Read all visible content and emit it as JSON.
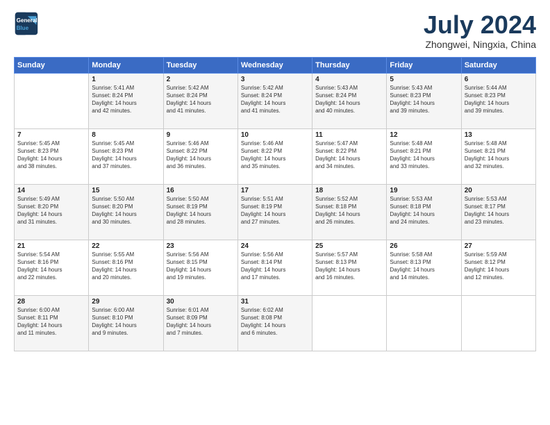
{
  "logo": {
    "line1": "General",
    "line2": "Blue"
  },
  "title": "July 2024",
  "subtitle": "Zhongwei, Ningxia, China",
  "header_days": [
    "Sunday",
    "Monday",
    "Tuesday",
    "Wednesday",
    "Thursday",
    "Friday",
    "Saturday"
  ],
  "weeks": [
    [
      {
        "day": "",
        "info": ""
      },
      {
        "day": "1",
        "info": "Sunrise: 5:41 AM\nSunset: 8:24 PM\nDaylight: 14 hours\nand 42 minutes."
      },
      {
        "day": "2",
        "info": "Sunrise: 5:42 AM\nSunset: 8:24 PM\nDaylight: 14 hours\nand 41 minutes."
      },
      {
        "day": "3",
        "info": "Sunrise: 5:42 AM\nSunset: 8:24 PM\nDaylight: 14 hours\nand 41 minutes."
      },
      {
        "day": "4",
        "info": "Sunrise: 5:43 AM\nSunset: 8:24 PM\nDaylight: 14 hours\nand 40 minutes."
      },
      {
        "day": "5",
        "info": "Sunrise: 5:43 AM\nSunset: 8:23 PM\nDaylight: 14 hours\nand 39 minutes."
      },
      {
        "day": "6",
        "info": "Sunrise: 5:44 AM\nSunset: 8:23 PM\nDaylight: 14 hours\nand 39 minutes."
      }
    ],
    [
      {
        "day": "7",
        "info": "Sunrise: 5:45 AM\nSunset: 8:23 PM\nDaylight: 14 hours\nand 38 minutes."
      },
      {
        "day": "8",
        "info": "Sunrise: 5:45 AM\nSunset: 8:23 PM\nDaylight: 14 hours\nand 37 minutes."
      },
      {
        "day": "9",
        "info": "Sunrise: 5:46 AM\nSunset: 8:22 PM\nDaylight: 14 hours\nand 36 minutes."
      },
      {
        "day": "10",
        "info": "Sunrise: 5:46 AM\nSunset: 8:22 PM\nDaylight: 14 hours\nand 35 minutes."
      },
      {
        "day": "11",
        "info": "Sunrise: 5:47 AM\nSunset: 8:22 PM\nDaylight: 14 hours\nand 34 minutes."
      },
      {
        "day": "12",
        "info": "Sunrise: 5:48 AM\nSunset: 8:21 PM\nDaylight: 14 hours\nand 33 minutes."
      },
      {
        "day": "13",
        "info": "Sunrise: 5:48 AM\nSunset: 8:21 PM\nDaylight: 14 hours\nand 32 minutes."
      }
    ],
    [
      {
        "day": "14",
        "info": "Sunrise: 5:49 AM\nSunset: 8:20 PM\nDaylight: 14 hours\nand 31 minutes."
      },
      {
        "day": "15",
        "info": "Sunrise: 5:50 AM\nSunset: 8:20 PM\nDaylight: 14 hours\nand 30 minutes."
      },
      {
        "day": "16",
        "info": "Sunrise: 5:50 AM\nSunset: 8:19 PM\nDaylight: 14 hours\nand 28 minutes."
      },
      {
        "day": "17",
        "info": "Sunrise: 5:51 AM\nSunset: 8:19 PM\nDaylight: 14 hours\nand 27 minutes."
      },
      {
        "day": "18",
        "info": "Sunrise: 5:52 AM\nSunset: 8:18 PM\nDaylight: 14 hours\nand 26 minutes."
      },
      {
        "day": "19",
        "info": "Sunrise: 5:53 AM\nSunset: 8:18 PM\nDaylight: 14 hours\nand 24 minutes."
      },
      {
        "day": "20",
        "info": "Sunrise: 5:53 AM\nSunset: 8:17 PM\nDaylight: 14 hours\nand 23 minutes."
      }
    ],
    [
      {
        "day": "21",
        "info": "Sunrise: 5:54 AM\nSunset: 8:16 PM\nDaylight: 14 hours\nand 22 minutes."
      },
      {
        "day": "22",
        "info": "Sunrise: 5:55 AM\nSunset: 8:16 PM\nDaylight: 14 hours\nand 20 minutes."
      },
      {
        "day": "23",
        "info": "Sunrise: 5:56 AM\nSunset: 8:15 PM\nDaylight: 14 hours\nand 19 minutes."
      },
      {
        "day": "24",
        "info": "Sunrise: 5:56 AM\nSunset: 8:14 PM\nDaylight: 14 hours\nand 17 minutes."
      },
      {
        "day": "25",
        "info": "Sunrise: 5:57 AM\nSunset: 8:13 PM\nDaylight: 14 hours\nand 16 minutes."
      },
      {
        "day": "26",
        "info": "Sunrise: 5:58 AM\nSunset: 8:13 PM\nDaylight: 14 hours\nand 14 minutes."
      },
      {
        "day": "27",
        "info": "Sunrise: 5:59 AM\nSunset: 8:12 PM\nDaylight: 14 hours\nand 12 minutes."
      }
    ],
    [
      {
        "day": "28",
        "info": "Sunrise: 6:00 AM\nSunset: 8:11 PM\nDaylight: 14 hours\nand 11 minutes."
      },
      {
        "day": "29",
        "info": "Sunrise: 6:00 AM\nSunset: 8:10 PM\nDaylight: 14 hours\nand 9 minutes."
      },
      {
        "day": "30",
        "info": "Sunrise: 6:01 AM\nSunset: 8:09 PM\nDaylight: 14 hours\nand 7 minutes."
      },
      {
        "day": "31",
        "info": "Sunrise: 6:02 AM\nSunset: 8:08 PM\nDaylight: 14 hours\nand 6 minutes."
      },
      {
        "day": "",
        "info": ""
      },
      {
        "day": "",
        "info": ""
      },
      {
        "day": "",
        "info": ""
      }
    ]
  ]
}
